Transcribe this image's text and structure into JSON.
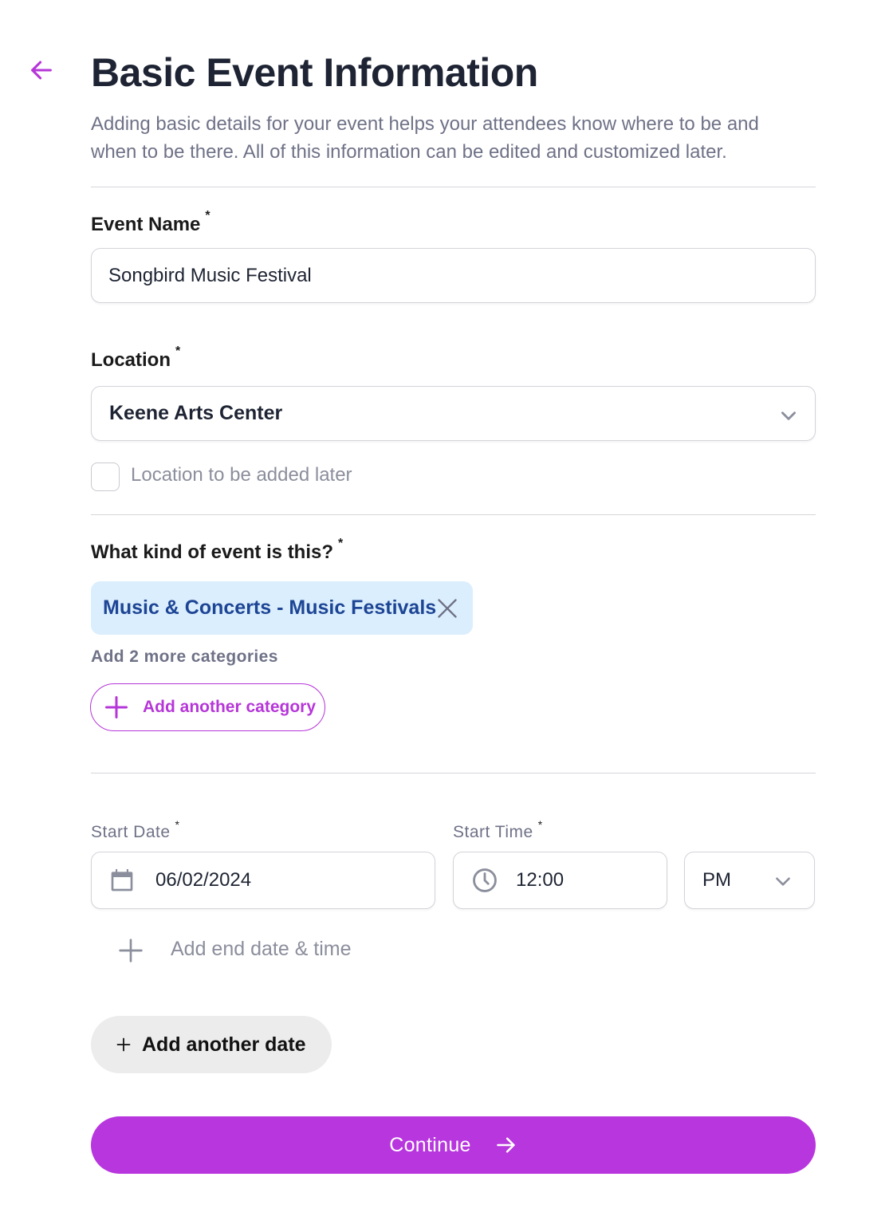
{
  "header": {
    "back_icon": "arrow-left-icon",
    "title": "Basic Event Information",
    "subtitle": "Adding basic details for your event helps your attendees know where to be and when to be there. All of this information can be edited and customized later."
  },
  "event_name": {
    "label": "Event Name",
    "required_mark": "*",
    "value": "Songbird Music Festival"
  },
  "location": {
    "label": "Location",
    "required_mark": "*",
    "value": "Keene Arts Center",
    "dropdown_icon": "chevron-down-icon",
    "later_checkbox_label": "Location to be added later",
    "later_checked": false
  },
  "category": {
    "label": "What kind of event is this?",
    "required_mark": "*",
    "selected": [
      {
        "label": "Music & Concerts - Music Festivals",
        "remove_icon": "close-icon"
      }
    ],
    "hint": "Add 2 more categories",
    "add_button_label": "Add another category",
    "add_icon": "plus-icon"
  },
  "schedule": {
    "start_date_label": "Start Date",
    "start_time_label": "Start Time",
    "required_mark": "*",
    "start_date": "06/02/2024",
    "start_time": "12:00",
    "meridiem": "PM",
    "date_icon": "calendar-icon",
    "time_icon": "clock-icon",
    "add_end_label": "Add end date & time",
    "add_date_button_label": "Add another date"
  },
  "footer": {
    "continue_label": "Continue",
    "continue_icon": "arrow-right-icon"
  },
  "colors": {
    "accent": "#b836de",
    "chip_bg": "#dbeefd",
    "chip_text": "#1d4595",
    "title_text": "#1e2433",
    "muted_text": "#6f7287"
  }
}
